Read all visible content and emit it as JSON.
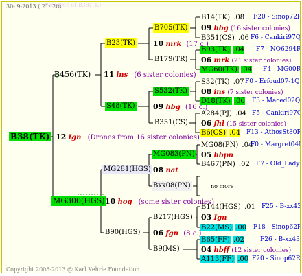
{
  "header": {
    "date": "30-  9-2013 ( 21: 20)",
    "title": "Pedigree of B38(TK) :"
  },
  "footer": {
    "copyright": "Copyright 2008-2013 @ Karl Kehrle Foundation."
  },
  "root": {
    "name": "B38(TK)"
  },
  "drones_label": {
    "count": "12",
    "origin": "Ign",
    "note": "(Drones from 16 sister colonies)"
  },
  "n1": {
    "name": "B456(TK)"
  },
  "n1_label": {
    "count": "11",
    "origin": "ins",
    "note": "(6 sister colonies)"
  },
  "n2": {
    "name": "MG300(HGS)"
  },
  "n2_label": {
    "count": "10",
    "origin": "hog",
    "note": "(some sister colonies)"
  },
  "g3": [
    {
      "name": "B23(TK)"
    },
    {
      "name": "S48(TK)"
    },
    {
      "name": "MG281(HGS)"
    },
    {
      "name": "B90(HGS)"
    }
  ],
  "g3_labels": [
    {
      "count": "",
      "origin": "",
      "note": ""
    },
    {
      "count": "",
      "origin": "",
      "note": ""
    },
    {
      "count": "",
      "origin": "",
      "note": ""
    },
    {
      "count": "",
      "origin": "",
      "note": ""
    }
  ],
  "g4": [
    {
      "name": "B705(TK)"
    },
    {
      "name": "B179(TR)"
    },
    {
      "name": "S532(TK)"
    },
    {
      "name": "B351(CS)"
    },
    {
      "name": "MG083(PN)"
    },
    {
      "name": "Bxx08(PN)"
    },
    {
      "name": "B217(HGS)"
    },
    {
      "name": "B9(MS)"
    }
  ],
  "g4_labels": [
    {
      "count": "10",
      "origin": "mrk",
      "note": "(17 c.)"
    },
    {
      "count": "09",
      "origin": "hbg",
      "note": "(16 c.)"
    },
    {
      "count": "08",
      "origin": "nat",
      "note": ""
    },
    {
      "count": "06",
      "origin": "fgn",
      "note": "(8 c.)"
    }
  ],
  "g5": [
    {
      "name": "B14(TK)",
      "year": ".08",
      "code": "F20 - Sinop72R"
    },
    {
      "name": "B351(CS)",
      "year": ".06",
      "code": "F6 - Cankiri97Q"
    },
    {
      "name": "B93(TK)",
      "year": ".04",
      "code": "F7 - NO6294R"
    },
    {
      "name": "MG60(TK)",
      "year": ".04",
      "code": "F4 - MG00R"
    },
    {
      "name": "S32(TK)",
      "year": ".07",
      "code": "F0 - Erfoud07-1Q"
    },
    {
      "name": "D18(TK)",
      "year": ".06",
      "code": "F3 - Maced02Q"
    },
    {
      "name": "A284(PJ)",
      "year": ".04",
      "code": "F5 - Cankiri97Q"
    },
    {
      "name": "B6(CS)",
      "year": ".04",
      "code": "F13 - AthosSt80R"
    },
    {
      "name": "MG08(PN)",
      "year": ".04",
      "code": "F0 - Margret04R"
    },
    {
      "name": "B467(PN)",
      "year": ".02",
      "code": "F7 - Old_Lady"
    },
    {
      "name": "no more",
      "year": "",
      "code": ""
    },
    {
      "name": "B144(HGS)",
      "year": ".01",
      "code": "F25 - B-xx43"
    },
    {
      "name": "B22(MS)",
      "year": ".00",
      "code": "F18 - Sinop62R"
    },
    {
      "name": "B65(FF)",
      "year": ".02",
      "code": "F26 - B-xx43"
    },
    {
      "name": "A113(FF)",
      "year": ".00",
      "code": "F20 - Sinop62R"
    }
  ],
  "g5_labels": [
    {
      "count": "09",
      "origin": "hbg",
      "note": "(16 sister colonies)"
    },
    {
      "count": "06",
      "origin": "mrk",
      "note": "(21 sister colonies)"
    },
    {
      "count": "08",
      "origin": "ins",
      "note": "(7 sister colonies)"
    },
    {
      "count": "06",
      "origin": "fhl",
      "note": "(15 sister colonies)"
    },
    {
      "count": "05",
      "origin": "hbpn",
      "note": ""
    },
    {
      "count": "03",
      "origin": "Ign",
      "note": ""
    },
    {
      "count": "04",
      "origin": "hbff",
      "note": "(12 sister colonies)"
    }
  ]
}
